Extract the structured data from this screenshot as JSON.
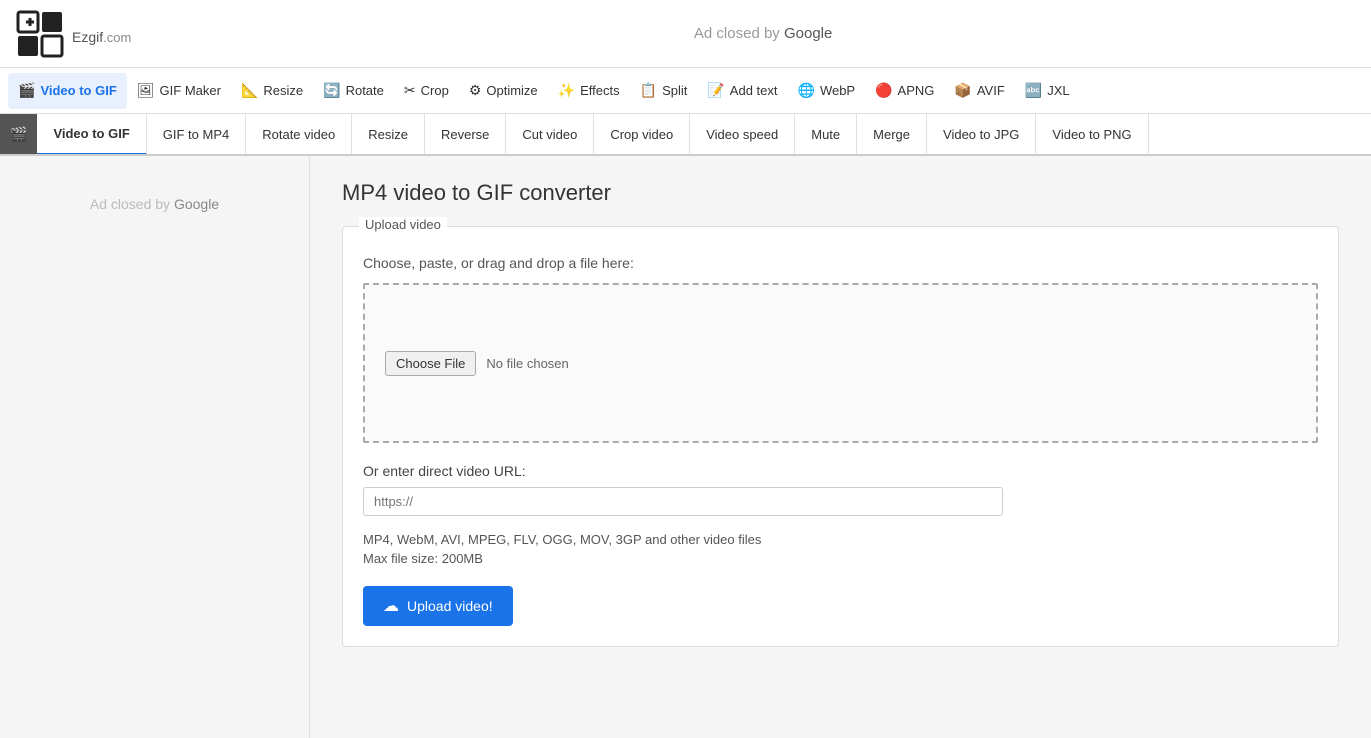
{
  "header": {
    "logo_text": "Ezgif",
    "logo_com": ".com",
    "ad_closed_text": "Ad closed by ",
    "ad_google": "Google"
  },
  "main_nav": {
    "items": [
      {
        "id": "gif-maker",
        "label": "GIF Maker",
        "icon": "🖼",
        "active": false
      },
      {
        "id": "video-to-gif",
        "label": "Video to GIF",
        "icon": "🎬",
        "active": true
      },
      {
        "id": "resize",
        "label": "Resize",
        "icon": "📐",
        "active": false
      },
      {
        "id": "rotate",
        "label": "Rotate",
        "icon": "🔄",
        "active": false
      },
      {
        "id": "crop",
        "label": "Crop",
        "icon": "✂",
        "active": false
      },
      {
        "id": "optimize",
        "label": "Optimize",
        "icon": "⚙",
        "active": false
      },
      {
        "id": "effects",
        "label": "Effects",
        "icon": "✨",
        "active": false
      },
      {
        "id": "split",
        "label": "Split",
        "icon": "📋",
        "active": false
      },
      {
        "id": "add-text",
        "label": "Add text",
        "icon": "📝",
        "active": false
      },
      {
        "id": "webp",
        "label": "WebP",
        "icon": "🌐",
        "active": false
      },
      {
        "id": "apng",
        "label": "APNG",
        "icon": "🔴",
        "active": false
      },
      {
        "id": "avif",
        "label": "AVIF",
        "icon": "📦",
        "active": false
      },
      {
        "id": "jxl",
        "label": "JXL",
        "icon": "🔤",
        "active": false
      }
    ]
  },
  "sub_nav": {
    "items": [
      {
        "id": "video-to-gif",
        "label": "Video to GIF",
        "active": true
      },
      {
        "id": "gif-to-mp4",
        "label": "GIF to MP4",
        "active": false
      },
      {
        "id": "rotate-video",
        "label": "Rotate video",
        "active": false
      },
      {
        "id": "resize",
        "label": "Resize",
        "active": false
      },
      {
        "id": "reverse",
        "label": "Reverse",
        "active": false
      },
      {
        "id": "cut-video",
        "label": "Cut video",
        "active": false
      },
      {
        "id": "crop-video",
        "label": "Crop video",
        "active": false
      },
      {
        "id": "video-speed",
        "label": "Video speed",
        "active": false
      },
      {
        "id": "mute",
        "label": "Mute",
        "active": false
      },
      {
        "id": "merge",
        "label": "Merge",
        "active": false
      },
      {
        "id": "video-to-jpg",
        "label": "Video to JPG",
        "active": false
      },
      {
        "id": "video-to-png",
        "label": "Video to PNG",
        "active": false
      }
    ]
  },
  "sidebar": {
    "ad_closed_text": "Ad closed by ",
    "ad_google": "Google"
  },
  "main": {
    "page_title": "MP4 video to GIF converter",
    "upload_section": {
      "legend": "Upload video",
      "hint": "Choose, paste, or drag and drop a file here:",
      "choose_file_label": "Choose File",
      "no_file_text": "No file chosen",
      "url_label": "Or enter direct video URL:",
      "url_placeholder": "https://",
      "supported_formats": "MP4, WebM, AVI, MPEG, FLV, OGG, MOV, 3GP and other video files",
      "max_size": "Max file size: 200MB",
      "upload_button": "Upload video!"
    }
  }
}
